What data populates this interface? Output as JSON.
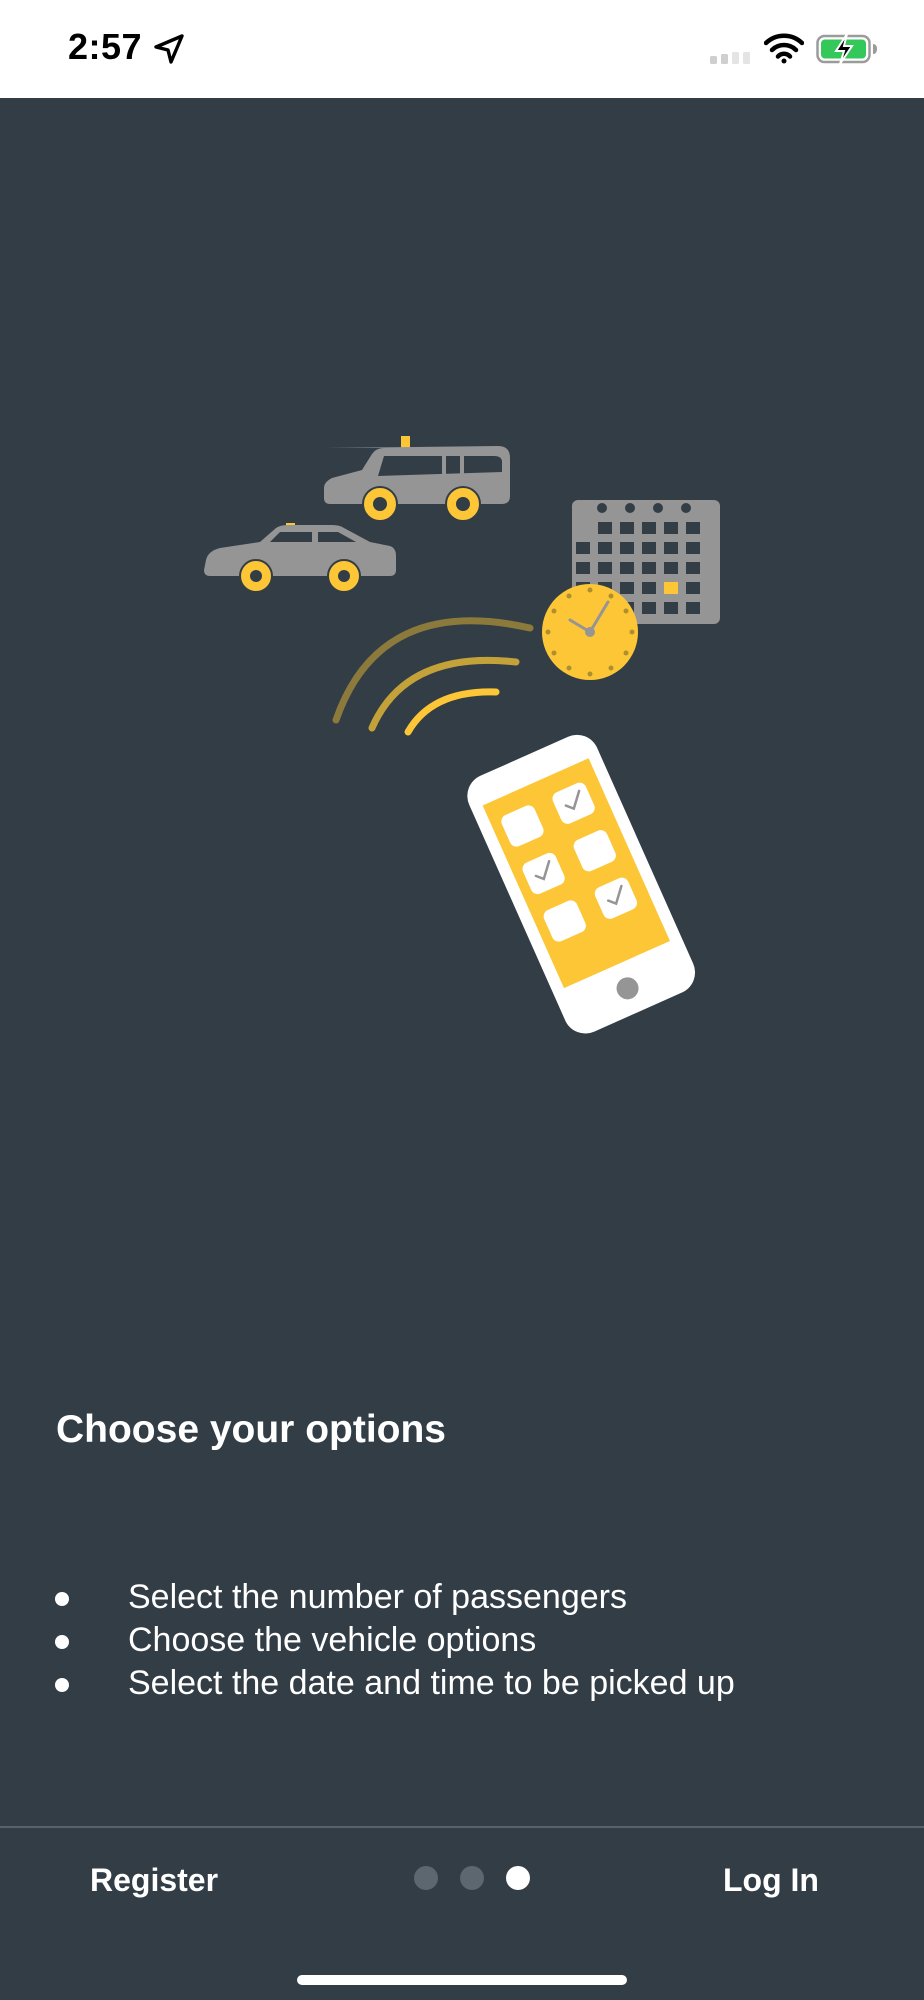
{
  "status_bar": {
    "time": "2:57",
    "icons": [
      "location-arrow-icon",
      "cellular-signal-icon",
      "wifi-icon",
      "battery-charging-icon"
    ],
    "battery_color": "#34c759"
  },
  "onboarding": {
    "illustration": "taxi-booking-illustration",
    "heading": "Choose your options",
    "bullets": [
      "Select the number of passengers",
      "Choose the vehicle options",
      "Select the date and time to be picked up"
    ]
  },
  "footer": {
    "register_label": "Register",
    "login_label": "Log In",
    "pagination": {
      "total": 3,
      "current": 3
    }
  },
  "colors": {
    "background": "#323d46",
    "accent_yellow": "#fcc636",
    "vehicle_gray": "#959595",
    "text": "#ffffff"
  }
}
